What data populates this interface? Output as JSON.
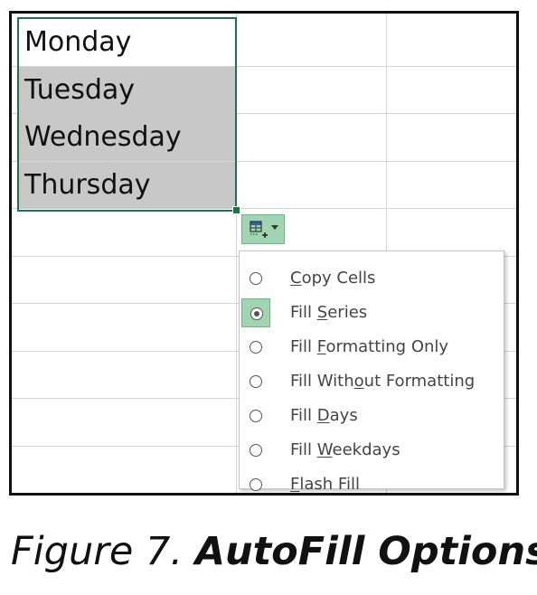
{
  "cells": [
    {
      "value": "Monday"
    },
    {
      "value": "Tuesday"
    },
    {
      "value": "Wednesday"
    },
    {
      "value": "Thursday"
    }
  ],
  "autofill_button": {
    "icon": "autofill-options-icon",
    "caret_icon": "dropdown-caret-icon"
  },
  "menu": {
    "selected_index": 1,
    "items": [
      {
        "pre": "",
        "ul": "C",
        "post": "opy Cells"
      },
      {
        "pre": "Fill ",
        "ul": "S",
        "post": "eries"
      },
      {
        "pre": "Fill ",
        "ul": "F",
        "post": "ormatting Only"
      },
      {
        "pre": "Fill With",
        "ul": "o",
        "post": "ut Formatting"
      },
      {
        "pre": "Fill ",
        "ul": "D",
        "post": "ays"
      },
      {
        "pre": "Fill ",
        "ul": "W",
        "post": "eekdays"
      },
      {
        "pre": "",
        "ul": "F",
        "post": "lash Fill"
      }
    ]
  },
  "caption": {
    "figure": "Figure 7. ",
    "title": "AutoFill Options"
  },
  "colors": {
    "selection_border": "#217346",
    "selected_fill": "#c8c8c8",
    "menu_highlight": "#9fd5b0",
    "gridline": "#d4d4d4"
  }
}
